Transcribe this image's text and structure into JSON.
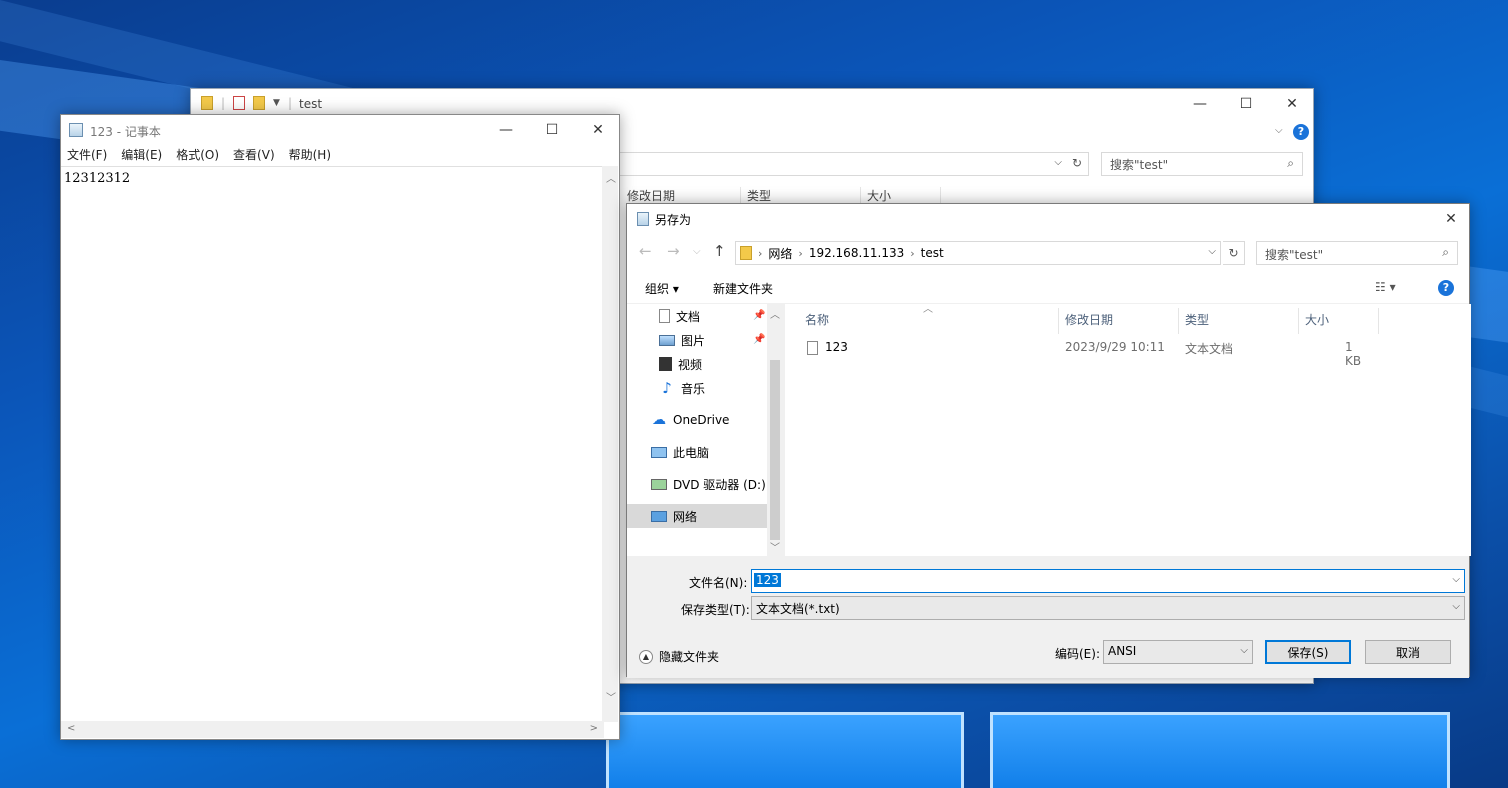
{
  "explorer": {
    "title": "test",
    "search_placeholder": "搜索\"test\"",
    "columns": [
      "修改日期",
      "类型",
      "大小"
    ]
  },
  "notepad": {
    "title": "123 - 记事本",
    "menu": [
      "文件(F)",
      "编辑(E)",
      "格式(O)",
      "查看(V)",
      "帮助(H)"
    ],
    "content": "12312312"
  },
  "save_dialog": {
    "title": "另存为",
    "breadcrumb": [
      "网络",
      "192.168.11.133",
      "test"
    ],
    "search_placeholder": "搜索\"test\"",
    "toolbar": {
      "organize": "组织 ▾",
      "new_folder": "新建文件夹"
    },
    "nav": {
      "documents": "文档",
      "pictures": "图片",
      "videos": "视频",
      "music": "音乐",
      "onedrive": "OneDrive",
      "this_pc": "此电脑",
      "dvd": "DVD 驱动器 (D:)",
      "network": "网络"
    },
    "columns": {
      "name": "名称",
      "modified": "修改日期",
      "type": "类型",
      "size": "大小"
    },
    "files": [
      {
        "name": "123",
        "modified": "2023/9/29 10:11",
        "type": "文本文档",
        "size": "1 KB"
      }
    ],
    "filename_label": "文件名(N):",
    "filename_value": "123",
    "filetype_label": "保存类型(T):",
    "filetype_value": "文本文档(*.txt)",
    "encoding_label": "编码(E):",
    "encoding_value": "ANSI",
    "save_button": "保存(S)",
    "cancel_button": "取消",
    "hide_folders": "隐藏文件夹"
  }
}
